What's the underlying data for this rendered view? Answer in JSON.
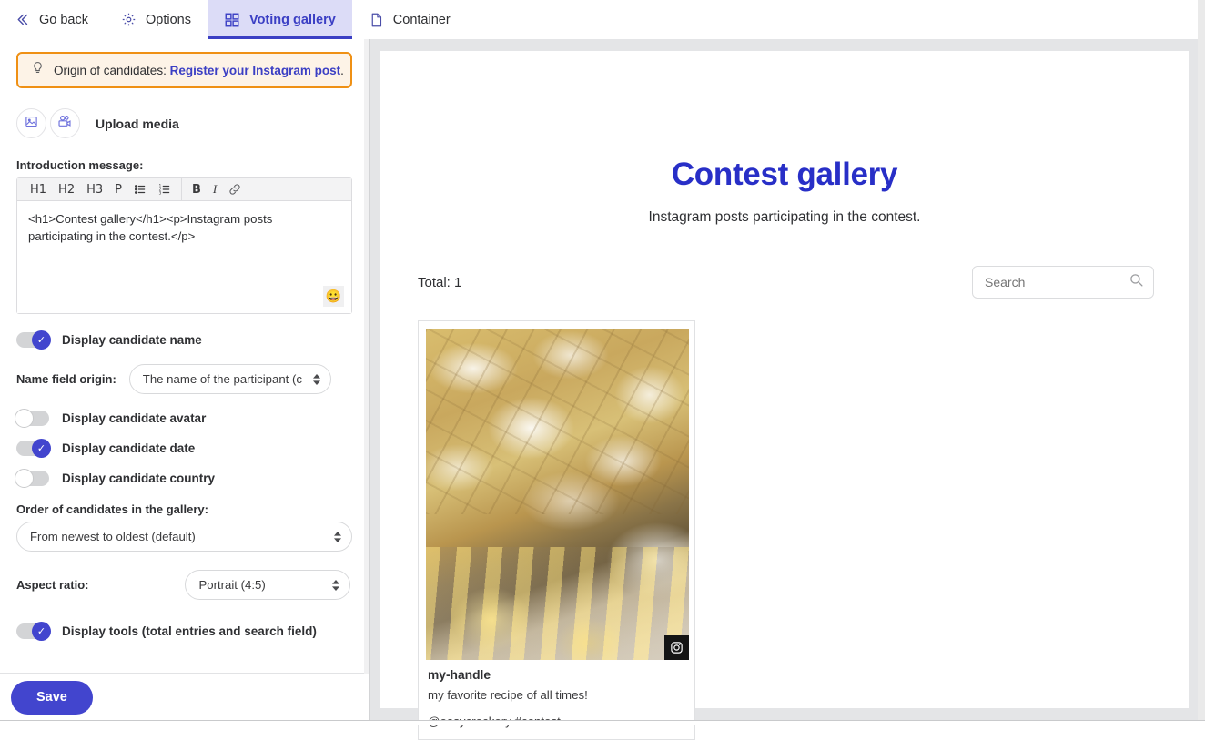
{
  "tabs": [
    {
      "label": "Go back",
      "icon": "chevrons-left-icon",
      "active": false
    },
    {
      "label": "Options",
      "icon": "gear-icon",
      "active": false
    },
    {
      "label": "Voting gallery",
      "icon": "grid-icon",
      "active": true
    },
    {
      "label": "Container",
      "icon": "document-icon",
      "active": false
    }
  ],
  "callout": {
    "icon": "lightbulb-icon",
    "text": "Origin of candidates: ",
    "link": "Register your Instagram post",
    "suffix": "."
  },
  "upload": {
    "image_icon": "image-icon",
    "video_icon": "video-camera-icon",
    "label": "Upload media"
  },
  "editor": {
    "label": "Introduction message:",
    "toolbar": [
      "H1",
      "H2",
      "H3",
      "P",
      "bulleted-list-icon",
      "numbered-list-icon",
      "B",
      "I",
      "link-icon"
    ],
    "value": "<h1>Contest gallery</h1><p>Instagram posts participating in the contest.</p>",
    "emoji_icon": "emoji-icon"
  },
  "settings": {
    "display_candidate_name": {
      "label": "Display candidate name",
      "on": true
    },
    "name_field_origin": {
      "label": "Name field origin:",
      "value": "The name of the participant (c",
      "options": [
        "The name of the participant (core field)"
      ]
    },
    "display_candidate_avatar": {
      "label": "Display candidate avatar",
      "on": false
    },
    "display_candidate_date": {
      "label": "Display candidate date",
      "on": true
    },
    "display_candidate_country": {
      "label": "Display candidate country",
      "on": false
    },
    "order_of_candidates": {
      "label": "Order of candidates in the gallery:",
      "value": "From newest to oldest (default)",
      "options": [
        "From newest to oldest (default)"
      ]
    },
    "aspect_ratio": {
      "label": "Aspect ratio:",
      "value": "Portrait (4:5)",
      "options": [
        "Portrait (4:5)"
      ]
    },
    "display_tools": {
      "label": "Display tools (total entries and search field)",
      "on": true
    }
  },
  "footer": {
    "save_label": "Save"
  },
  "preview": {
    "title": "Contest gallery",
    "subtitle": "Instagram posts participating in the contest.",
    "total_label": "Total: 1",
    "search_placeholder": "Search",
    "search_value": "",
    "search_icon": "search-icon",
    "cards": [
      {
        "handle": "my-handle",
        "caption": "my favorite recipe of all times!",
        "tags": "@easycrockery #contest",
        "badge_icon": "instagram-icon",
        "media_alt": "powdered sugar pastries on a baking tray"
      }
    ]
  },
  "colors": {
    "accent": "#4245ce",
    "title": "#282fc7",
    "callout_border": "#ef9014",
    "callout_bg": "#fdf3e7",
    "tab_active_bg": "#dcdcf7",
    "panel_bg": "#e4e5e7"
  }
}
